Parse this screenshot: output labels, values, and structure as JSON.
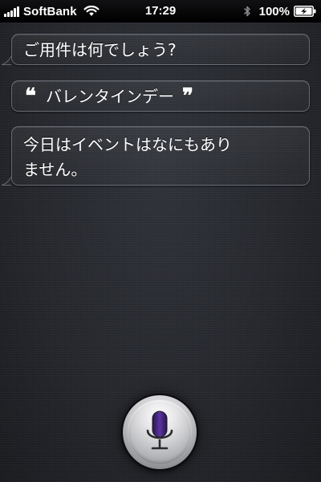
{
  "status_bar": {
    "carrier": "SoftBank",
    "time": "17:29",
    "battery_percent": "100%",
    "icons": [
      "signal-bars-icon",
      "wifi-icon",
      "bluetooth-icon",
      "battery-charging-icon"
    ]
  },
  "conversation": {
    "prompt": "ご用件は何でしょう?",
    "user_query": "バレンタインデー",
    "quote_open": "❝",
    "quote_close": "❞",
    "response_line1": "今日はイベントはなにもあり",
    "response_line2": "ません。"
  },
  "mic_button": {
    "icon": "microphone-icon",
    "accent_color": "#4b2a8a"
  }
}
